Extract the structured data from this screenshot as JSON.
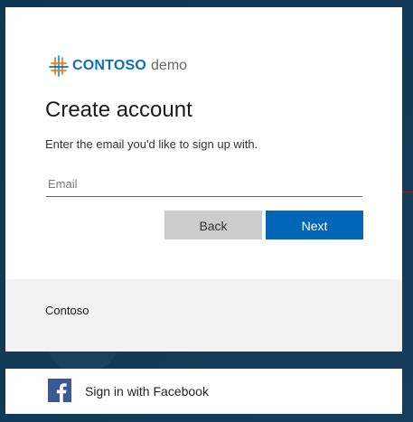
{
  "brand": {
    "name": "CONTOSO",
    "suffix": "demo",
    "logo_icon": "contoso-logo-icon"
  },
  "form": {
    "title": "Create account",
    "subtitle": "Enter the email you'd like to sign up with.",
    "email": {
      "placeholder": "Email",
      "value": ""
    },
    "buttons": {
      "back": "Back",
      "next": "Next"
    }
  },
  "footer": {
    "text": "Contoso"
  },
  "social": {
    "facebook_label": "Sign in with Facebook",
    "facebook_icon": "facebook-icon"
  },
  "colors": {
    "background": "#0f3a58",
    "card": "#ffffff",
    "footer_bg": "#f2f2f2",
    "brand_blue": "#0e6fb8",
    "primary_button": "#0067b8",
    "secondary_button": "#cccccc",
    "facebook_blue": "#3b5998"
  }
}
